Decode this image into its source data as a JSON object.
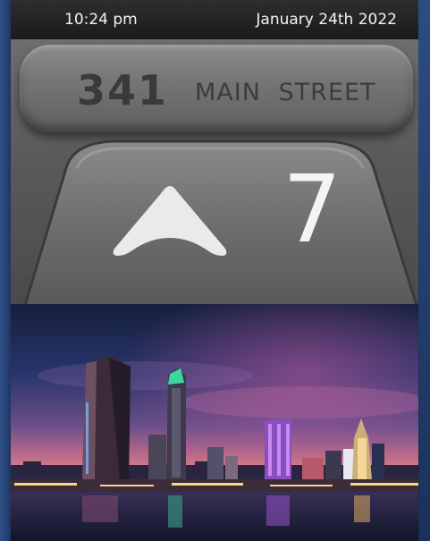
{
  "status_bar": {
    "time": "10:24 pm",
    "date": "January 24th 2022"
  },
  "address": {
    "number": "341",
    "street": "MAIN STREET"
  },
  "elevator": {
    "direction": "up",
    "direction_icon": "up-arrow-icon",
    "floor": "7"
  },
  "media": {
    "image_subject": "city-skyline-night"
  },
  "colors": {
    "status_bar": "#1a1a1b",
    "panel_grey": "#5a5a5c",
    "plate_text": "#3a3a3c",
    "floor_text": "#f4f4f4",
    "frame_blue": "#1d2f52"
  }
}
